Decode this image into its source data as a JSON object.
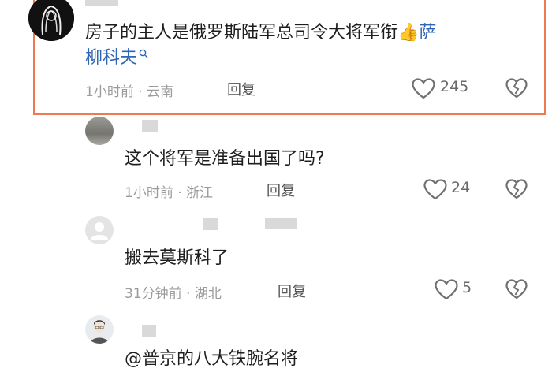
{
  "comments": [
    {
      "text_main": "房子的主人是俄罗斯陆军总司令大将军衔",
      "emoji": "👍",
      "link_text_1": "萨",
      "link_text_2": "柳科夫",
      "time": "1小时前",
      "location": "云南",
      "reply_label": "回复",
      "likes": "245"
    },
    {
      "text": "这个将军是准备出国了吗?",
      "time": "1小时前",
      "location": "浙江",
      "reply_label": "回复",
      "likes": "24"
    },
    {
      "text": "搬去莫斯科了",
      "time": "31分钟前",
      "location": "湖北",
      "reply_label": "回复",
      "likes": "5"
    },
    {
      "text": "@普京的八大铁腕名将"
    }
  ],
  "separator": "·",
  "colors": {
    "highlight": "#ef7a4d",
    "link": "#2f66b3"
  },
  "icons": [
    "heart-icon",
    "broken-heart-icon",
    "search-icon",
    "thumbs-up-icon",
    "default-avatar-icon"
  ]
}
